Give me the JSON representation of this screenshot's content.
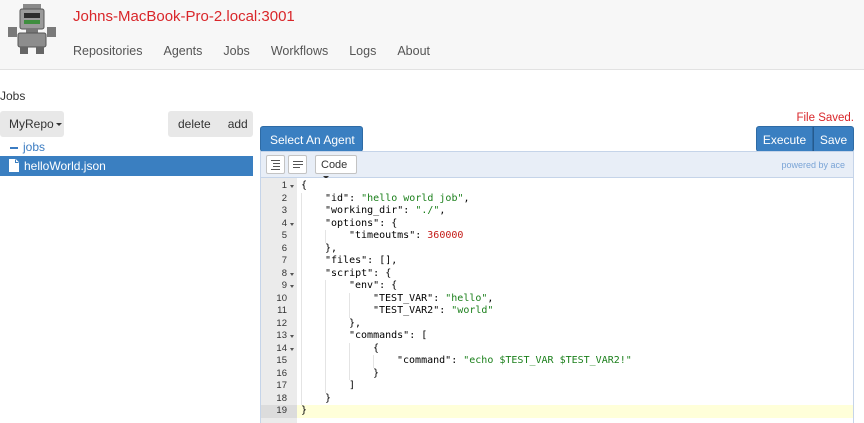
{
  "header": {
    "host": "Johns-MacBook-Pro-2.local:3001",
    "nav": [
      "Repositories",
      "Agents",
      "Jobs",
      "Workflows",
      "Logs",
      "About"
    ]
  },
  "page_title": "Jobs",
  "left_pane": {
    "repo_select": "MyRepo",
    "delete_label": "delete",
    "add_label": "add",
    "tree_root": "jobs",
    "selected_file": "helloWorld.json"
  },
  "right_pane": {
    "status": "File Saved.",
    "agent_select": "Select An Agent",
    "execute_label": "Execute",
    "save_label": "Save"
  },
  "editor": {
    "mode": "Code",
    "powered_by": "powered by ace",
    "active_line": 19,
    "lines": [
      {
        "n": "1",
        "fold": true,
        "indent": 0,
        "parts": [
          [
            "p",
            "{"
          ]
        ]
      },
      {
        "n": "2",
        "fold": false,
        "indent": 1,
        "parts": [
          [
            "k",
            "\"id\""
          ],
          [
            "p",
            ": "
          ],
          [
            "s",
            "\"hello world job\""
          ],
          [
            "p",
            ","
          ]
        ]
      },
      {
        "n": "3",
        "fold": false,
        "indent": 1,
        "parts": [
          [
            "k",
            "\"working_dir\""
          ],
          [
            "p",
            ": "
          ],
          [
            "s",
            "\"./\""
          ],
          [
            "p",
            ","
          ]
        ]
      },
      {
        "n": "4",
        "fold": true,
        "indent": 1,
        "parts": [
          [
            "k",
            "\"options\""
          ],
          [
            "p",
            ": {"
          ]
        ]
      },
      {
        "n": "5",
        "fold": false,
        "indent": 2,
        "parts": [
          [
            "k",
            "\"timeoutms\""
          ],
          [
            "p",
            ": "
          ],
          [
            "m",
            "360000"
          ]
        ]
      },
      {
        "n": "6",
        "fold": false,
        "indent": 1,
        "parts": [
          [
            "p",
            "},"
          ]
        ]
      },
      {
        "n": "7",
        "fold": false,
        "indent": 1,
        "parts": [
          [
            "k",
            "\"files\""
          ],
          [
            "p",
            ": [],"
          ]
        ]
      },
      {
        "n": "8",
        "fold": true,
        "indent": 1,
        "parts": [
          [
            "k",
            "\"script\""
          ],
          [
            "p",
            ": {"
          ]
        ]
      },
      {
        "n": "9",
        "fold": true,
        "indent": 2,
        "parts": [
          [
            "k",
            "\"env\""
          ],
          [
            "p",
            ": {"
          ]
        ]
      },
      {
        "n": "10",
        "fold": false,
        "indent": 3,
        "parts": [
          [
            "k",
            "\"TEST_VAR\""
          ],
          [
            "p",
            ": "
          ],
          [
            "s",
            "\"hello\""
          ],
          [
            "p",
            ","
          ]
        ]
      },
      {
        "n": "11",
        "fold": false,
        "indent": 3,
        "parts": [
          [
            "k",
            "\"TEST_VAR2\""
          ],
          [
            "p",
            ": "
          ],
          [
            "s",
            "\"world\""
          ]
        ]
      },
      {
        "n": "12",
        "fold": false,
        "indent": 2,
        "parts": [
          [
            "p",
            "},"
          ]
        ]
      },
      {
        "n": "13",
        "fold": true,
        "indent": 2,
        "parts": [
          [
            "k",
            "\"commands\""
          ],
          [
            "p",
            ": ["
          ]
        ]
      },
      {
        "n": "14",
        "fold": true,
        "indent": 3,
        "parts": [
          [
            "p",
            "{"
          ]
        ]
      },
      {
        "n": "15",
        "fold": false,
        "indent": 4,
        "parts": [
          [
            "k",
            "\"command\""
          ],
          [
            "p",
            ": "
          ],
          [
            "s",
            "\"echo $TEST_VAR $TEST_VAR2!\""
          ]
        ]
      },
      {
        "n": "16",
        "fold": false,
        "indent": 3,
        "parts": [
          [
            "p",
            "}"
          ]
        ]
      },
      {
        "n": "17",
        "fold": false,
        "indent": 2,
        "parts": [
          [
            "p",
            "]"
          ]
        ]
      },
      {
        "n": "18",
        "fold": false,
        "indent": 1,
        "parts": [
          [
            "p",
            "}"
          ]
        ]
      },
      {
        "n": "19",
        "fold": false,
        "indent": 0,
        "parts": [
          [
            "p",
            "}"
          ]
        ]
      }
    ]
  },
  "colors": {
    "brand_red": "#d9262a",
    "primary_blue": "#3a7fc1",
    "string_green": "#1a7f1a",
    "number_red": "#c41a16"
  }
}
